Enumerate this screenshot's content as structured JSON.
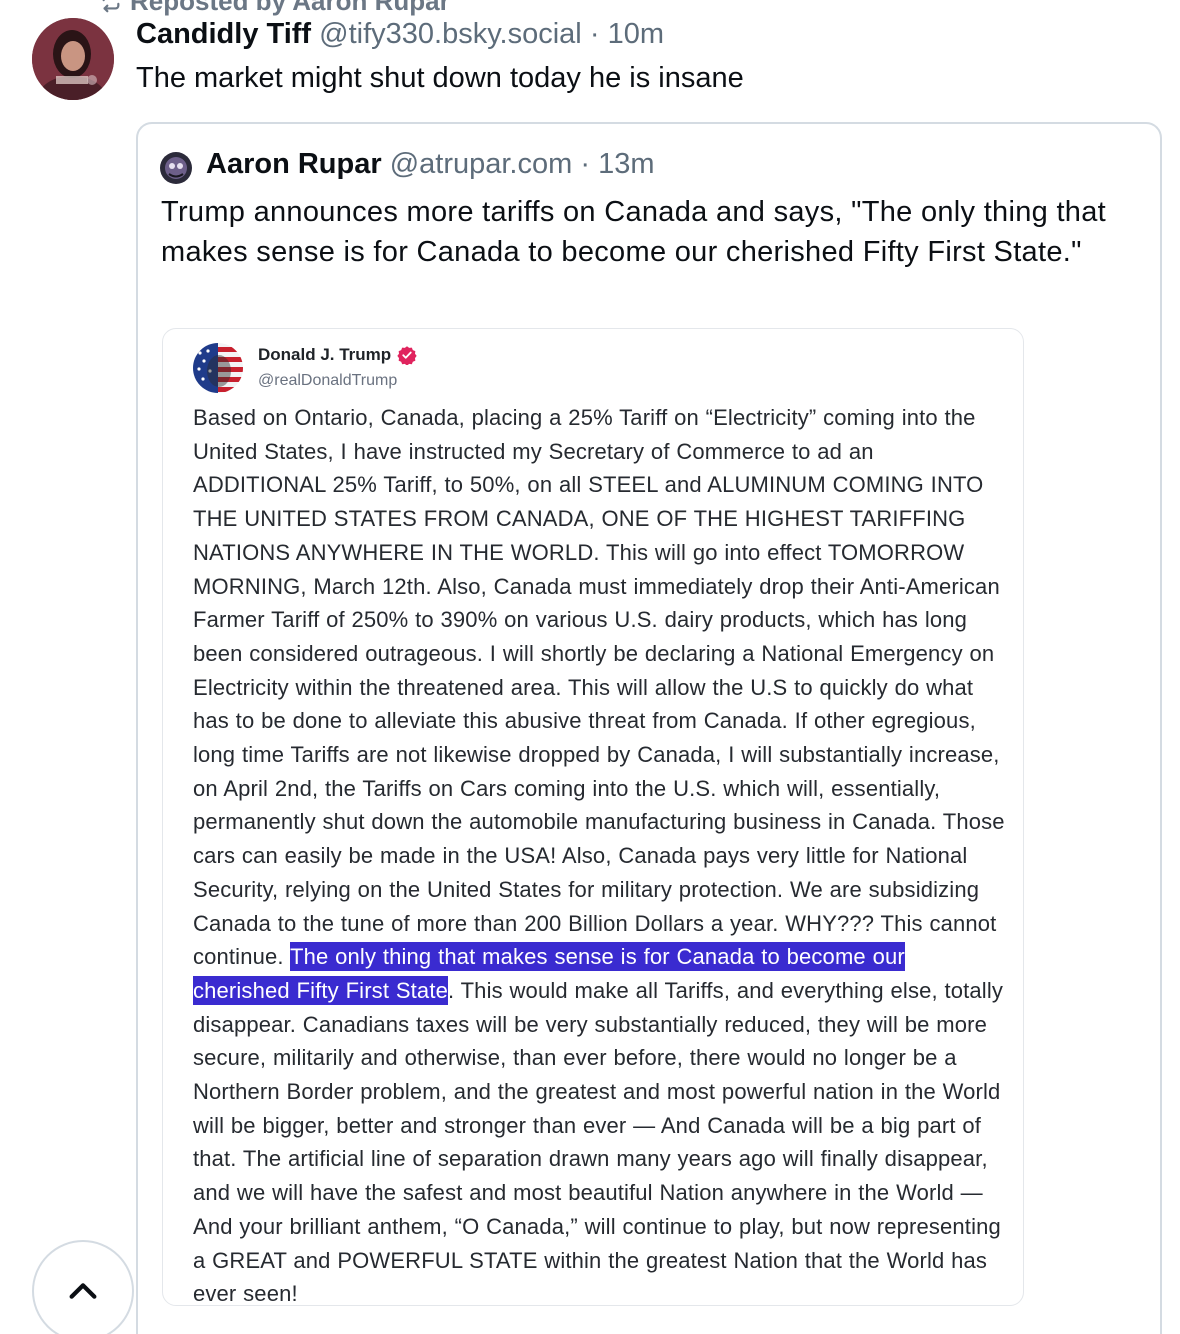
{
  "repost": {
    "label": "Reposted by Aaron Rupar",
    "icon": "repost-icon"
  },
  "post": {
    "display_name": "Candidly Tiff",
    "handle": "@tify330.bsky.social",
    "separator": "·",
    "time": "10m",
    "text": "The market might shut down today he is insane"
  },
  "quote": {
    "display_name": "Aaron Rupar",
    "handle": "@atrupar.com",
    "separator": "·",
    "time": "13m",
    "text": "Trump announces more tariffs on Canada and says, \"The only thing that makes sense is for Canada to become our cherished Fifty First State.\""
  },
  "embed": {
    "display_name": "Donald J. Trump",
    "handle": "@realDonaldTrump",
    "verified_color": "#e0245e",
    "body_before": "Based on Ontario, Canada, placing a 25% Tariff on “Electricity” coming into the United States, I have instructed my Secretary of Commerce to ad an ADDITIONAL 25% Tariff, to 50%, on all STEEL and ALUMINUM COMING INTO THE UNITED STATES FROM CANADA, ONE OF THE HIGHEST TARIFFING NATIONS ANYWHERE IN THE WORLD. This will go into effect TOMORROW MORNING, March 12th. Also, Canada must immediately drop their Anti-American Farmer Tariff of 250% to 390% on various U.S. dairy products, which has long been considered outrageous. I will shortly be declaring a National Emergency on Electricity within the threatened area. This will allow the U.S to quickly do what has to be done to alleviate this abusive threat from Canada. If other egregious, long time Tariffs are not likewise dropped by Canada, I will substantially increase, on April 2nd, the Tariffs on Cars coming into the U.S. which will, essentially, permanently shut down the automobile manufacturing business in Canada. Those cars can easily be made in the USA! Also, Canada pays very little for National Security, relying on the United States for military protection. We are subsidizing Canada to the tune of more than 200 Billion Dollars a year. WHY??? This cannot continue. ",
    "body_highlight": "The only thing that makes sense is for Canada to become our cherished Fifty First State",
    "body_after": ". This would make all Tariffs, and everything else, totally disappear. Canadians taxes will be very substantially reduced, they will be more secure, militarily and otherwise, than ever before, there would no longer be a Northern Border problem, and the greatest and most powerful nation in the World will be bigger, better and stronger than ever — And Canada will be a big part of that. The artificial line of separation drawn many years ago will finally disappear, and we will have the safest and most beautiful Nation anywhere in the World — And your brilliant anthem, “O Canada,” will continue to play, but now representing a GREAT and POWERFUL STATE within the greatest Nation that the World has ever seen!",
    "highlight_color": "#3a2bd0"
  },
  "scroll_top": {
    "icon": "chevron-up-icon"
  }
}
